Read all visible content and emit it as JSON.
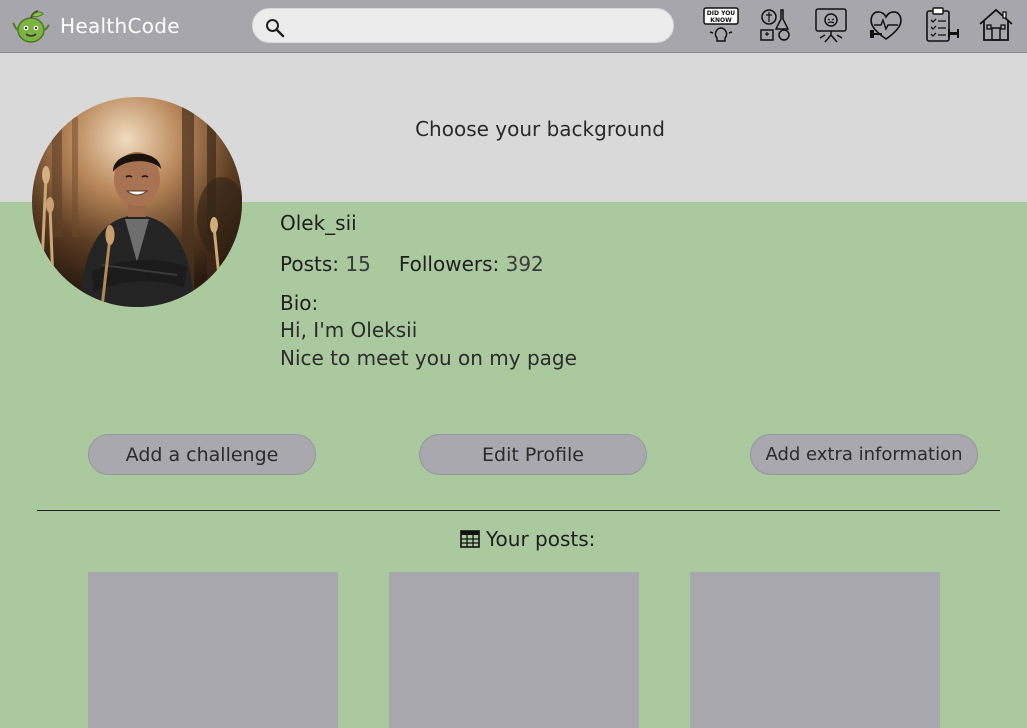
{
  "app": {
    "name": "HealthCode"
  },
  "search": {
    "value": "",
    "placeholder": ""
  },
  "nav": {
    "icons": [
      "did-you-know-icon",
      "science-icon",
      "stress-icon",
      "heart-fitness-icon",
      "checklist-icon",
      "home-icon"
    ],
    "did_you_know_text": [
      "DID YOU",
      "KNOW"
    ]
  },
  "banner": {
    "label": "Choose your background"
  },
  "profile": {
    "username": "Olek_sii",
    "posts_label": "Posts:",
    "posts_count": "15",
    "followers_label": "Followers:",
    "followers_count": "392",
    "bio_label": "Bio:",
    "bio_lines": [
      "Hi, I'm Oleksii",
      "Nice to meet you on my page"
    ]
  },
  "actions": {
    "add_challenge": "Add a challenge",
    "edit_profile": "Edit Profile",
    "add_extra": "Add extra information"
  },
  "posts": {
    "heading": "Your posts:",
    "count_visible": 3
  },
  "colors": {
    "navbar": "#a7a6ac",
    "banner": "#d9d9d9",
    "page_background": "#abc99e",
    "button": "#a9a8ae",
    "post_placeholder": "#a8a7ad"
  }
}
